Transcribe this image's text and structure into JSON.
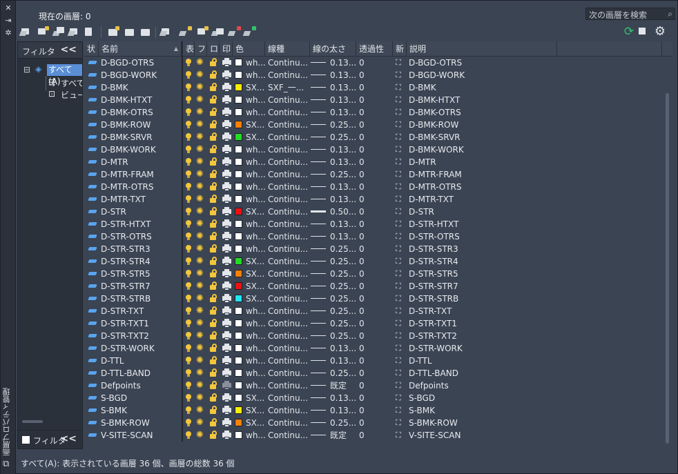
{
  "palette": {
    "accent": "#5a8fd6",
    "layer_on": "#f3c63d",
    "refresh_green": "#34c26a"
  },
  "header": {
    "current_layer": "現在の画層: 0",
    "search_placeholder": "次の画層を検索",
    "panel_title": "画層プロパティ管理"
  },
  "filter_panel": {
    "title": "フィルタ",
    "collapse_label": "<<",
    "tree": {
      "root": "すべて(A)",
      "child_1": "すべて(",
      "child_2": "ビューポ"
    },
    "invert_filter_label": "フィルタ"
  },
  "columns": {
    "status": "状",
    "name": "名前",
    "on": "表",
    "freeze": "フ.",
    "lock": "ロ.",
    "plot": "印",
    "color": "色",
    "linetype": "線種",
    "lineweight": "線の太さ",
    "transparency": "透過性",
    "new_vp_freeze": "新",
    "description": "説明"
  },
  "layers": [
    {
      "name": "D-BGD-OTRS",
      "color": "#ffffff",
      "color_label": "wh...",
      "linetype": "Continu...",
      "lineweight": "0.13...",
      "thick": false,
      "transparency": "0",
      "description": "D-BGD-OTRS",
      "plot_dim": false
    },
    {
      "name": "D-BGD-WORK",
      "color": "#ffffff",
      "color_label": "wh...",
      "linetype": "Continu...",
      "lineweight": "0.13...",
      "thick": false,
      "transparency": "0",
      "description": "D-BGD-WORK",
      "plot_dim": false
    },
    {
      "name": "D-BMK",
      "color": "#ffee00",
      "color_label": "SX...",
      "linetype": "SXF_一...",
      "lineweight": "0.13...",
      "thick": false,
      "transparency": "0",
      "description": "D-BMK",
      "plot_dim": false
    },
    {
      "name": "D-BMK-HTXT",
      "color": "#ffffff",
      "color_label": "wh...",
      "linetype": "Continu...",
      "lineweight": "0.13...",
      "thick": false,
      "transparency": "0",
      "description": "D-BMK-HTXT",
      "plot_dim": false
    },
    {
      "name": "D-BMK-OTRS",
      "color": "#ffffff",
      "color_label": "wh...",
      "linetype": "Continu...",
      "lineweight": "0.13...",
      "thick": false,
      "transparency": "0",
      "description": "D-BMK-OTRS",
      "plot_dim": false
    },
    {
      "name": "D-BMK-ROW",
      "color": "#ff8000",
      "color_label": "SX...",
      "linetype": "Continu...",
      "lineweight": "0.25...",
      "thick": false,
      "transparency": "0",
      "description": "D-BMK-ROW",
      "plot_dim": false
    },
    {
      "name": "D-BMK-SRVR",
      "color": "#22dd22",
      "color_label": "SX...",
      "linetype": "Continu...",
      "lineweight": "0.25...",
      "thick": false,
      "transparency": "0",
      "description": "D-BMK-SRVR",
      "plot_dim": false
    },
    {
      "name": "D-BMK-WORK",
      "color": "#ffffff",
      "color_label": "wh...",
      "linetype": "Continu...",
      "lineweight": "0.13...",
      "thick": false,
      "transparency": "0",
      "description": "D-BMK-WORK",
      "plot_dim": false
    },
    {
      "name": "D-MTR",
      "color": "#ffffff",
      "color_label": "wh...",
      "linetype": "Continu...",
      "lineweight": "0.13...",
      "thick": false,
      "transparency": "0",
      "description": "D-MTR",
      "plot_dim": false
    },
    {
      "name": "D-MTR-FRAM",
      "color": "#ffffff",
      "color_label": "wh...",
      "linetype": "Continu...",
      "lineweight": "0.25...",
      "thick": false,
      "transparency": "0",
      "description": "D-MTR-FRAM",
      "plot_dim": false
    },
    {
      "name": "D-MTR-OTRS",
      "color": "#ffffff",
      "color_label": "wh...",
      "linetype": "Continu...",
      "lineweight": "0.13...",
      "thick": false,
      "transparency": "0",
      "description": "D-MTR-OTRS",
      "plot_dim": false
    },
    {
      "name": "D-MTR-TXT",
      "color": "#ffffff",
      "color_label": "wh...",
      "linetype": "Continu...",
      "lineweight": "0.13...",
      "thick": false,
      "transparency": "0",
      "description": "D-MTR-TXT",
      "plot_dim": false
    },
    {
      "name": "D-STR",
      "color": "#ee1111",
      "color_label": "SX...",
      "linetype": "Continu...",
      "lineweight": "0.50...",
      "thick": true,
      "transparency": "0",
      "description": "D-STR",
      "plot_dim": false
    },
    {
      "name": "D-STR-HTXT",
      "color": "#ffffff",
      "color_label": "wh...",
      "linetype": "Continu...",
      "lineweight": "0.13...",
      "thick": false,
      "transparency": "0",
      "description": "D-STR-HTXT",
      "plot_dim": false
    },
    {
      "name": "D-STR-OTRS",
      "color": "#ffffff",
      "color_label": "wh...",
      "linetype": "Continu...",
      "lineweight": "0.13...",
      "thick": false,
      "transparency": "0",
      "description": "D-STR-OTRS",
      "plot_dim": false
    },
    {
      "name": "D-STR-STR3",
      "color": "#ffffff",
      "color_label": "wh...",
      "linetype": "Continu...",
      "lineweight": "0.25...",
      "thick": false,
      "transparency": "0",
      "description": "D-STR-STR3",
      "plot_dim": false
    },
    {
      "name": "D-STR-STR4",
      "color": "#22dd22",
      "color_label": "SX...",
      "linetype": "Continu...",
      "lineweight": "0.25...",
      "thick": false,
      "transparency": "0",
      "description": "D-STR-STR4",
      "plot_dim": false
    },
    {
      "name": "D-STR-STR5",
      "color": "#ff8000",
      "color_label": "SX...",
      "linetype": "Continu...",
      "lineweight": "0.25...",
      "thick": false,
      "transparency": "0",
      "description": "D-STR-STR5",
      "plot_dim": false
    },
    {
      "name": "D-STR-STR7",
      "color": "#ee1111",
      "color_label": "SX...",
      "linetype": "Continu...",
      "lineweight": "0.25...",
      "thick": false,
      "transparency": "0",
      "description": "D-STR-STR7",
      "plot_dim": false
    },
    {
      "name": "D-STR-STRB",
      "color": "#22e5f0",
      "color_label": "SX...",
      "linetype": "Continu...",
      "lineweight": "0.25...",
      "thick": false,
      "transparency": "0",
      "description": "D-STR-STRB",
      "plot_dim": false
    },
    {
      "name": "D-STR-TXT",
      "color": "#ffffff",
      "color_label": "wh...",
      "linetype": "Continu...",
      "lineweight": "0.25...",
      "thick": false,
      "transparency": "0",
      "description": "D-STR-TXT",
      "plot_dim": false
    },
    {
      "name": "D-STR-TXT1",
      "color": "#ffffff",
      "color_label": "wh...",
      "linetype": "Continu...",
      "lineweight": "0.25...",
      "thick": false,
      "transparency": "0",
      "description": "D-STR-TXT1",
      "plot_dim": false
    },
    {
      "name": "D-STR-TXT2",
      "color": "#ffffff",
      "color_label": "wh...",
      "linetype": "Continu...",
      "lineweight": "0.25...",
      "thick": false,
      "transparency": "0",
      "description": "D-STR-TXT2",
      "plot_dim": false
    },
    {
      "name": "D-STR-WORK",
      "color": "#ffffff",
      "color_label": "wh...",
      "linetype": "Continu...",
      "lineweight": "0.13...",
      "thick": false,
      "transparency": "0",
      "description": "D-STR-WORK",
      "plot_dim": false
    },
    {
      "name": "D-TTL",
      "color": "#ffffff",
      "color_label": "wh...",
      "linetype": "Continu...",
      "lineweight": "0.13...",
      "thick": false,
      "transparency": "0",
      "description": "D-TTL",
      "plot_dim": false
    },
    {
      "name": "D-TTL-BAND",
      "color": "#ffffff",
      "color_label": "wh...",
      "linetype": "Continu...",
      "lineweight": "0.25...",
      "thick": false,
      "transparency": "0",
      "description": "D-TTL-BAND",
      "plot_dim": false
    },
    {
      "name": "Defpoints",
      "color": "#ffffff",
      "color_label": "wh...",
      "linetype": "Continu...",
      "lineweight": "既定",
      "thick": false,
      "transparency": "0",
      "description": "Defpoints",
      "plot_dim": true
    },
    {
      "name": "S-BGD",
      "color": "#ffffff",
      "color_label": "SX...",
      "linetype": "Continu...",
      "lineweight": "0.13...",
      "thick": false,
      "transparency": "0",
      "description": "S-BGD",
      "plot_dim": false
    },
    {
      "name": "S-BMK",
      "color": "#ffee00",
      "color_label": "SX...",
      "linetype": "Continu...",
      "lineweight": "0.13...",
      "thick": false,
      "transparency": "0",
      "description": "S-BMK",
      "plot_dim": false
    },
    {
      "name": "S-BMK-ROW",
      "color": "#ff8000",
      "color_label": "SX...",
      "linetype": "Continu...",
      "lineweight": "0.25...",
      "thick": false,
      "transparency": "0",
      "description": "S-BMK-ROW",
      "plot_dim": false
    },
    {
      "name": "V-SITE-SCAN",
      "color": "#ffffff",
      "color_label": "wh...",
      "linetype": "Continu...",
      "lineweight": "既定",
      "thick": false,
      "transparency": "0",
      "description": "V-SITE-SCAN",
      "plot_dim": false
    }
  ],
  "status_bar": {
    "text": "すべて(A): 表示されている画層 36 個、画層の総数 36 個"
  },
  "icons": {
    "close": "close-icon",
    "pin": "pin-icon",
    "settings": "gear-icon",
    "refresh": "refresh-icon"
  }
}
